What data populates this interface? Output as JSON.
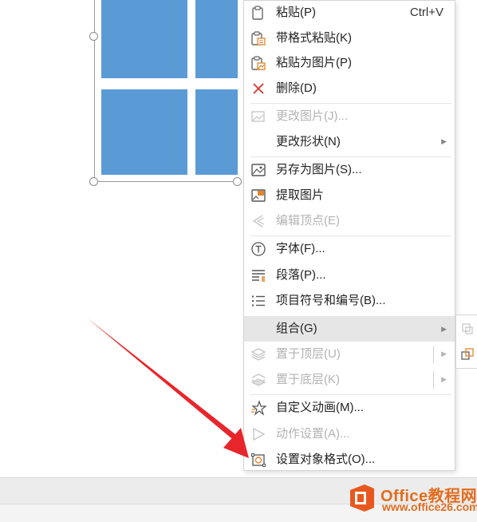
{
  "context_menu": {
    "items": [
      {
        "label": "粘贴(P)",
        "shortcut": "Ctrl+V",
        "icon": "paste-icon",
        "enabled": true
      },
      {
        "label": "带格式粘贴(K)",
        "icon": "paste-with-format-icon",
        "enabled": true
      },
      {
        "label": "粘贴为图片(P)",
        "icon": "paste-as-picture-icon",
        "enabled": true
      },
      {
        "label": "删除(D)",
        "icon": "delete-icon",
        "enabled": true
      },
      {
        "label": "更改图片(J)...",
        "icon": "change-picture-icon",
        "enabled": false
      },
      {
        "label": "更改形状(N)",
        "icon": "",
        "enabled": true,
        "submenu": true
      },
      {
        "label": "另存为图片(S)...",
        "icon": "save-as-picture-icon",
        "enabled": true
      },
      {
        "label": "提取图片",
        "icon": "extract-picture-icon",
        "enabled": true
      },
      {
        "label": "编辑顶点(E)",
        "icon": "edit-points-icon",
        "enabled": false
      },
      {
        "label": "字体(F)...",
        "icon": "font-icon",
        "enabled": true
      },
      {
        "label": "段落(P)...",
        "icon": "paragraph-icon",
        "enabled": true
      },
      {
        "label": "项目符号和编号(B)...",
        "icon": "bullets-icon",
        "enabled": true
      },
      {
        "label": "组合(G)",
        "icon": "",
        "enabled": true,
        "submenu": true,
        "highlighted": true
      },
      {
        "label": "置于顶层(U)",
        "icon": "bring-to-front-icon",
        "enabled": false,
        "submenu": true
      },
      {
        "label": "置于底层(K)",
        "icon": "send-to-back-icon",
        "enabled": false,
        "submenu": true
      },
      {
        "label": "自定义动画(M)...",
        "icon": "custom-animation-icon",
        "enabled": true
      },
      {
        "label": "动作设置(A)...",
        "icon": "action-settings-icon",
        "enabled": false
      },
      {
        "label": "设置对象格式(O)...",
        "icon": "format-object-icon",
        "enabled": true
      }
    ]
  },
  "watermark": {
    "title": "Office教程网",
    "url": "www.office26.com"
  },
  "colors": {
    "tile_blue": "#5b9bd5",
    "arrow_red": "#e8252b",
    "logo_orange": "#e36c1e"
  }
}
